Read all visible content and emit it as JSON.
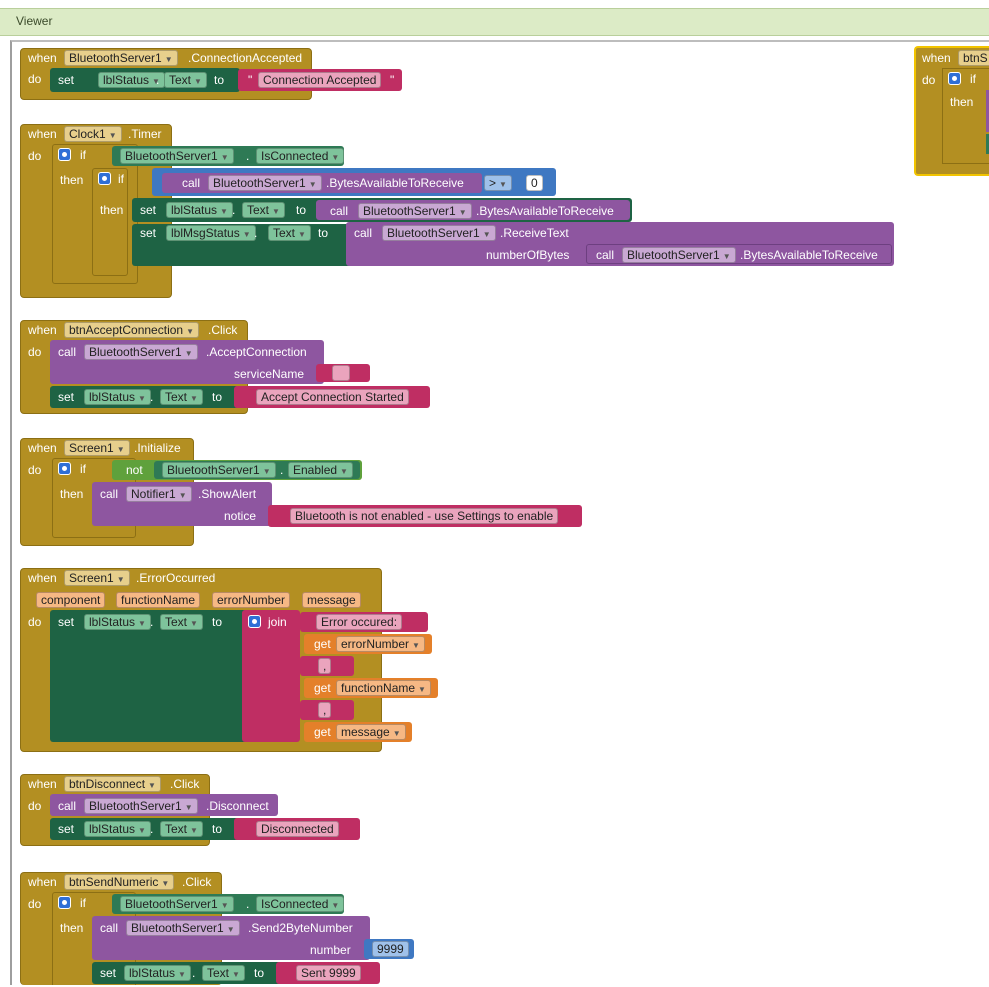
{
  "viewer": {
    "title": "Viewer"
  },
  "kw": {
    "when": "when",
    "do": "do",
    "set": "set",
    "to": "to",
    "call": "call",
    "if": "if",
    "then": "then",
    "not": "not",
    "join": "join",
    "get": "get",
    "dot": "."
  },
  "b1": {
    "component": "BluetoothServer1",
    "event": ".ConnectionAccepted",
    "target": "lblStatus",
    "prop": "Text",
    "text": "Connection Accepted"
  },
  "b2": {
    "component": "Clock1",
    "event": ".Timer",
    "cond_comp": "BluetoothServer1",
    "cond_prop": "IsConnected",
    "inner_call_comp": "BluetoothServer1",
    "inner_call_method": ".BytesAvailableToReceive",
    "op": ">",
    "num": "0",
    "set1_target": "lblStatus",
    "set1_prop": "Text",
    "set1_comp": "BluetoothServer1",
    "set1_method": ".BytesAvailableToReceive",
    "set2_target": "lblMsgStatus",
    "set2_prop": "Text",
    "set2_comp": "BluetoothServer1",
    "set2_method": ".ReceiveText",
    "param": "numberOfBytes",
    "param_comp": "BluetoothServer1",
    "param_method": ".BytesAvailableToReceive"
  },
  "b3": {
    "component": "btnAcceptConnection",
    "event": ".Click",
    "call_comp": "BluetoothServer1",
    "call_method": ".AcceptConnection",
    "param": "serviceName",
    "target": "lblStatus",
    "prop": "Text",
    "text": "Accept Connection Started"
  },
  "b4": {
    "component": "Screen1",
    "event": ".Initialize",
    "cond_comp": "BluetoothServer1",
    "cond_prop": "Enabled",
    "call_comp": "Notifier1",
    "call_method": ".ShowAlert",
    "param": "notice",
    "text": "Bluetooth is not enabled - use Settings to enable"
  },
  "b5": {
    "component": "Screen1",
    "event": ".ErrorOccurred",
    "params": [
      "component",
      "functionName",
      "errorNumber",
      "message"
    ],
    "target": "lblStatus",
    "prop": "Text",
    "str1": "Error occured: ",
    "get1": "errorNumber",
    "str2": ",",
    "get2": "functionName",
    "str3": ",",
    "get3": "message"
  },
  "b6": {
    "component": "btnDisconnect",
    "event": ".Click",
    "call_comp": "BluetoothServer1",
    "call_method": ".Disconnect",
    "target": "lblStatus",
    "prop": "Text",
    "text": "Disconnected"
  },
  "b7": {
    "component": "btnSendNumeric",
    "event": ".Click",
    "cond_comp": "BluetoothServer1",
    "cond_prop": "IsConnected",
    "call_comp": "BluetoothServer1",
    "call_method": ".Send2ByteNumber",
    "param": "number",
    "num": "9999",
    "target": "lblStatus",
    "prop": "Text",
    "text": "Sent 9999"
  },
  "b8": {
    "component": "btnS"
  }
}
